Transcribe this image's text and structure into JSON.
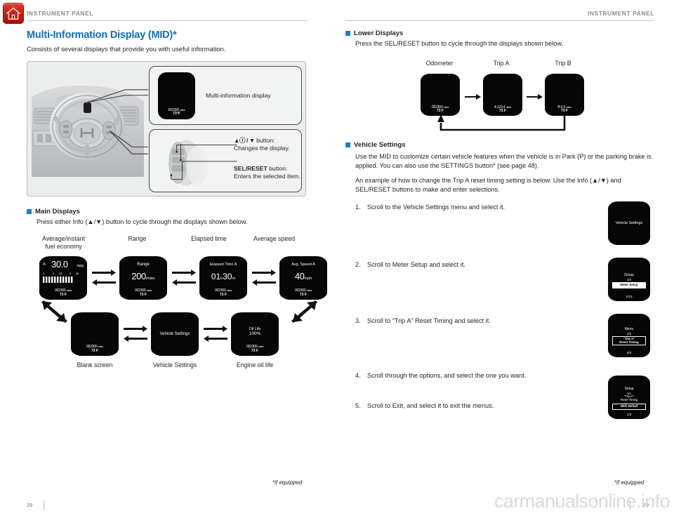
{
  "meta": {
    "home_icon": "home-icon",
    "watermark": "carmanualsonline.info"
  },
  "left_page": {
    "running_head": "INSTRUMENT PANEL",
    "title": "Multi-Information Display (MID)*",
    "lede": "Consists of several displays that provide you with useful information.",
    "diagram": {
      "mid_screen": {
        "odometer": "002300",
        "odo_unit": "miles",
        "temp": "73°F"
      },
      "callout_1_label": "Multi-information display",
      "callout_2": {
        "button_symbols": "▲ⓘ / ▼",
        "line1_bold": " button:",
        "line2": "Changes the display.",
        "line3_bold": "SEL/RESET",
        "line3_rest": " button:",
        "line4": "Enters the selected item."
      }
    },
    "main_displays": {
      "heading": "Main Displays",
      "body": "Press either Info (▲/▼) button to cycle through the displays shown below.",
      "top_labels": [
        "Average/instant\nfuel economy",
        "Range",
        "Elapsed time",
        "Average speed"
      ],
      "bottom_labels": [
        "Blank screen",
        "Vehicle Settings",
        "Engine oil life"
      ],
      "screens_top": [
        {
          "kind": "fuel",
          "prefix": "A",
          "value": "30.0",
          "unit": "mpg",
          "odo": "002300",
          "odo_unit": "miles",
          "temp": "73 F"
        },
        {
          "kind": "simple",
          "title": "Range",
          "value": "200",
          "unit": "miles",
          "odo": "002300",
          "odo_unit": "miles",
          "temp": "73 F"
        },
        {
          "kind": "time",
          "title": "Elapsed Time A",
          "value": "01",
          "unit": "h",
          "value2": "30",
          "unit2": "m",
          "odo": "002300",
          "odo_unit": "miles",
          "temp": "73 F"
        },
        {
          "kind": "simple",
          "title": "Avg. Speed A",
          "value": "40",
          "unit": "mph",
          "odo": "002300",
          "odo_unit": "miles",
          "temp": "73 F"
        }
      ],
      "screens_bottom": [
        {
          "kind": "blank",
          "odo": "002300",
          "odo_unit": "miles",
          "temp": "73 F"
        },
        {
          "kind": "center",
          "title": "Vehicle Settings"
        },
        {
          "kind": "oil",
          "title": "Oil Life",
          "value": "100%",
          "odo": "002300",
          "odo_unit": "miles",
          "temp": "73 F"
        }
      ]
    },
    "footnote": "*if equipped",
    "page_number": "28"
  },
  "right_page": {
    "running_head": "INSTRUMENT PANEL",
    "lower_displays": {
      "heading": "Lower Displays",
      "body": "Press the SEL/RESET button to cycle through the displays shown below.",
      "labels": [
        "Odometer",
        "Trip A",
        "Trip B"
      ],
      "screens": [
        {
          "odo": "002300",
          "odo_unit": "miles",
          "temp": "73 F"
        },
        {
          "odo": "A 123.4",
          "odo_unit": "miles",
          "temp": "73 F"
        },
        {
          "odo": "B 0.0",
          "odo_unit": "miles",
          "temp": "73 F"
        }
      ]
    },
    "vehicle_settings": {
      "heading": "Vehicle Settings",
      "para_1": "Use the MID to customize certain vehicle features when the vehicle is in Park (P) or the parking brake is applied. You can also use the SETTINGS button* (see page 48).",
      "para_2": "An example of how to change the Trip A reset timing setting is below. Use the Info (▲/▼) and SEL/RESET buttons to make and enter selections.",
      "steps": [
        {
          "num": "1.",
          "text": "Scroll to the Vehicle Settings menu and select it."
        },
        {
          "num": "2.",
          "text": "Scroll to Meter Setup and select it."
        },
        {
          "num": "3.",
          "text": "Scroll to “Trip A” Reset Timing and select it."
        },
        {
          "num": "4.",
          "text": "Scroll through the options, and select the one you want."
        },
        {
          "num": "5.",
          "text": "Scroll to Exit, and select it to exit the menus."
        }
      ],
      "step_shots": [
        {
          "center_title": "Vehicle Settings"
        },
        {
          "top": "Group",
          "sub": "1/3",
          "highlight": "Meter Setup",
          "bottom": "1/10"
        },
        {
          "top": "Menu",
          "sub": "2/3",
          "highlight": "“Trip A”\nReset Timing",
          "bottom": "3/3"
        },
        {
          "top": "Setup",
          "sub": "3/3",
          "sub2": "“Trip A”\nReset Timing",
          "highlight": "With Refuel",
          "bottom": "1/3"
        }
      ]
    },
    "footnote": "*if equipped",
    "page_number": "29"
  }
}
